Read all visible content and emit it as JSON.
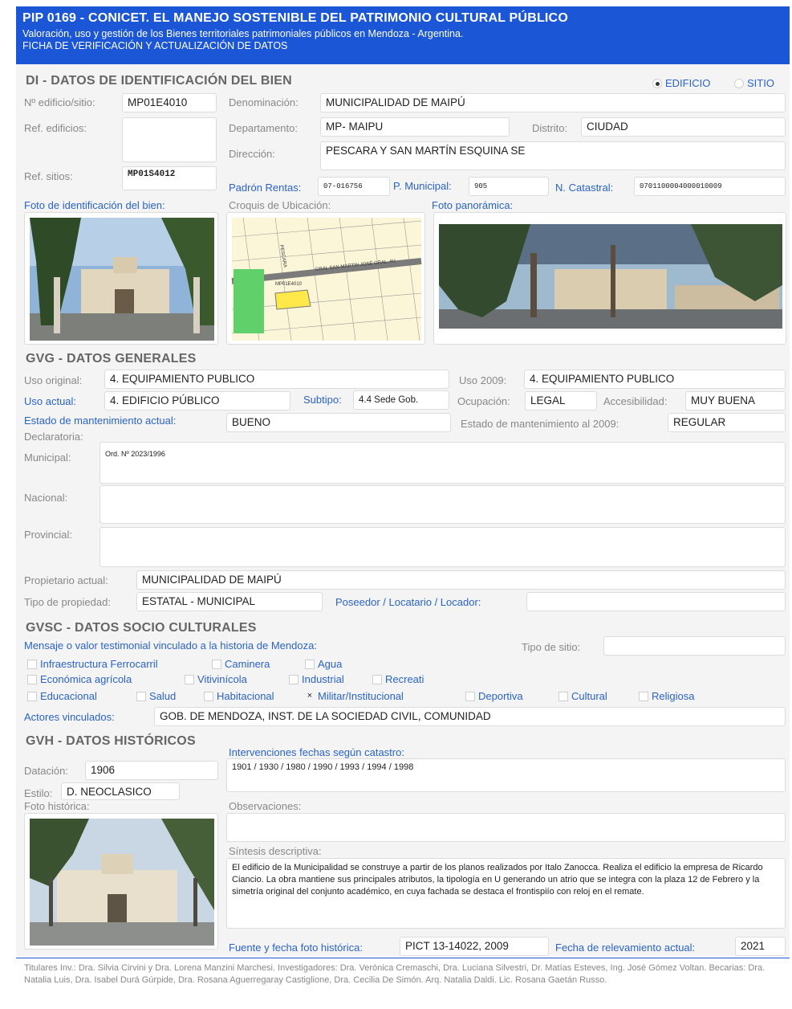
{
  "header": {
    "title": "PIP 0169 - CONICET.  EL MANEJO SOSTENIBLE DEL PATRIMONIO CULTURAL PÚBLICO",
    "subtitle": "Valoración, uso y gestión de los Bienes territoriales patrimoniales públicos en Mendoza - Argentina.",
    "form_title": "FICHA DE VERIFICACIÓN Y ACTUALIZACIÓN DE DATOS"
  },
  "di": {
    "section_title": "DI - DATOS DE IDENTIFICACIÓN DEL BIEN",
    "type_options": [
      {
        "label": "EDIFICIO",
        "selected": true
      },
      {
        "label": "SITIO",
        "selected": false
      }
    ],
    "edificio_label": "Nº edificio/sitio:",
    "edificio_value": "MP01E4010",
    "denominacion_label": "Denominación:",
    "denominacion_value": "MUNICIPALIDAD DE MAIPÚ",
    "ref_edificios_label": "Ref. edificios:",
    "ref_edificios_value": "",
    "departamento_label": "Departamento:",
    "departamento_value": "MP- MAIPU",
    "distrito_label": "Distrito:",
    "distrito_value": "CIUDAD",
    "direccion_label": "Dirección:",
    "direccion_value": "PESCARA Y SAN MARTÍN ESQUINA SE",
    "ref_sitios_label": "Ref. sitios:",
    "ref_sitios_value": "MP01S4012",
    "padron_label": "Padrón Rentas:",
    "padron_value": "07-016756",
    "municipal_label": "P. Municipal:",
    "municipal_value": "905",
    "catastral_label": "N. Catastral:",
    "catastral_value": "0701100004000010009",
    "foto_id_label": "Foto de identificación del bien:",
    "croquis_label": "Croquis de Ubicación:",
    "panoramica_label": "Foto panorámica:",
    "map_street_label": "PESCARA",
    "map_avenue_label": "GRAL SAN MARTIN JOSÉ GRAL. AV.",
    "map_site_label": "MP01E4010"
  },
  "gvg": {
    "section_title": "GVG - DATOS GENERALES",
    "uso_original_label": "Uso original:",
    "uso_original_value": "4. EQUIPAMIENTO PUBLICO",
    "uso_2009_label": "Uso 2009:",
    "uso_2009_value": "4. EQUIPAMIENTO PUBLICO",
    "uso_actual_label": "Uso actual:",
    "uso_actual_value": "4. EDIFICIO PÚBLICO",
    "subtipo_label": "Subtipo:",
    "subtipo_value": "4.4 Sede Gob.",
    "ocupacion_label": "Ocupación:",
    "ocupacion_value": "LEGAL",
    "accesibilidad_label": "Accesibilidad:",
    "accesibilidad_value": "MUY BUENA",
    "estado_actual_label": "Estado de mantenimiento actual:",
    "estado_actual_value": "BUENO",
    "estado_2009_label": "Estado de mantenimiento al 2009:",
    "estado_2009_value": "REGULAR",
    "declaratoria_label": "Declaratoria:",
    "municipal_label": "Municipal:",
    "municipal_value": "Ord. Nº 2023/1996",
    "nacional_label": "Nacional:",
    "nacional_value": "",
    "provincial_label": "Provincial:",
    "provincial_value": "",
    "propietario_label": "Propietario actual:",
    "propietario_value": "MUNICIPALIDAD DE MAIPÚ",
    "tipo_prop_label": "Tipo de propiedad:",
    "tipo_prop_value": "ESTATAL - MUNICIPAL",
    "poseedor_label": "Poseedor / Locatario / Locador:",
    "poseedor_value": ""
  },
  "gvsc": {
    "section_title": "GVSC - DATOS SOCIO CULTURALES",
    "mensaje_label": "Mensaje o valor testimonial vinculado a la historia de Mendoza:",
    "tipo_sitio_label": "Tipo de sitio:",
    "tipo_sitio_value": "",
    "row1": [
      {
        "label": "Infraestructura Ferrocarril",
        "checked": false
      },
      {
        "label": "Caminera",
        "checked": false
      },
      {
        "label": "Agua",
        "checked": false
      }
    ],
    "row2": [
      {
        "label": "Económica agrícola",
        "checked": false
      },
      {
        "label": "Vitivinícola",
        "checked": false
      },
      {
        "label": "Industrial",
        "checked": false
      },
      {
        "label": "Recreati",
        "checked": false
      }
    ],
    "row3": [
      {
        "label": "Educacional",
        "checked": false
      },
      {
        "label": "Salud",
        "checked": false
      },
      {
        "label": "Habitacional",
        "checked": false
      },
      {
        "label": "Militar/Institucional",
        "checked": true
      },
      {
        "label": "Deportiva",
        "checked": false
      },
      {
        "label": "Cultural",
        "checked": false
      },
      {
        "label": "Religiosa",
        "checked": false
      }
    ],
    "actores_label": "Actores vinculados:",
    "actores_value": "GOB. DE MENDOZA, INST. DE LA SOCIEDAD CIVIL, COMUNIDAD"
  },
  "gvh": {
    "section_title": "GVH - DATOS HISTÓRICOS",
    "intervenciones_label": "Intervenciones fechas según catastro:",
    "intervenciones_value": "1901 / 1930 / 1980 / 1990 / 1993 / 1994 / 1998",
    "datacion_label": "Datación:",
    "datacion_value": "1906",
    "estilo_label": "Estilo:",
    "estilo_value": "D. NEOCLASICO",
    "foto_hist_label": "Foto histórica:",
    "observaciones_label": "Observaciones:",
    "observaciones_value": "",
    "sintesis_label": "Síntesis descriptiva:",
    "sintesis_value": "El  edificio de la Municipalidad se construye a partir de los planos realizados por Italo Zanocca. Realiza el edificio la empresa de Ricardo Ciancio. La obra mantiene sus principales atributos, la tipología en U generando un atrio que se integra con la plaza 12 de Febrero y la simetría  original del conjunto  académico, en cuya fachada se destaca el frontispiío con reloj  en el remate.",
    "fuente_label": "Fuente y fecha foto histórica:",
    "fuente_value": "PICT 13-14022, 2009",
    "fecha_label": "Fecha de relevamiento actual:",
    "fecha_value": "2021"
  },
  "footer": {
    "credits": "Titulares Inv.: Dra. Silvia Cirvini y Dra. Lorena Manzini Marchesi. Investigadores: Dra. Verónica Cremaschi, Dra. Luciana Silvestri, Dr. Matías Esteves, Ing. José Gómez Voltan. Becarias: Dra. Natalia Luis, Dra. Isabel Durá Gúrpide, Dra. Rosana Aguerregaray Castiglione, Dra. Cecilia De Simón. Arq. Natalia Daldi. Lic. Rosana Gaetán Russo."
  },
  "colors": {
    "header_bg": "#1a56d6",
    "label_blue": "#2a63c8",
    "panel_bg": "#f4f4f4"
  }
}
